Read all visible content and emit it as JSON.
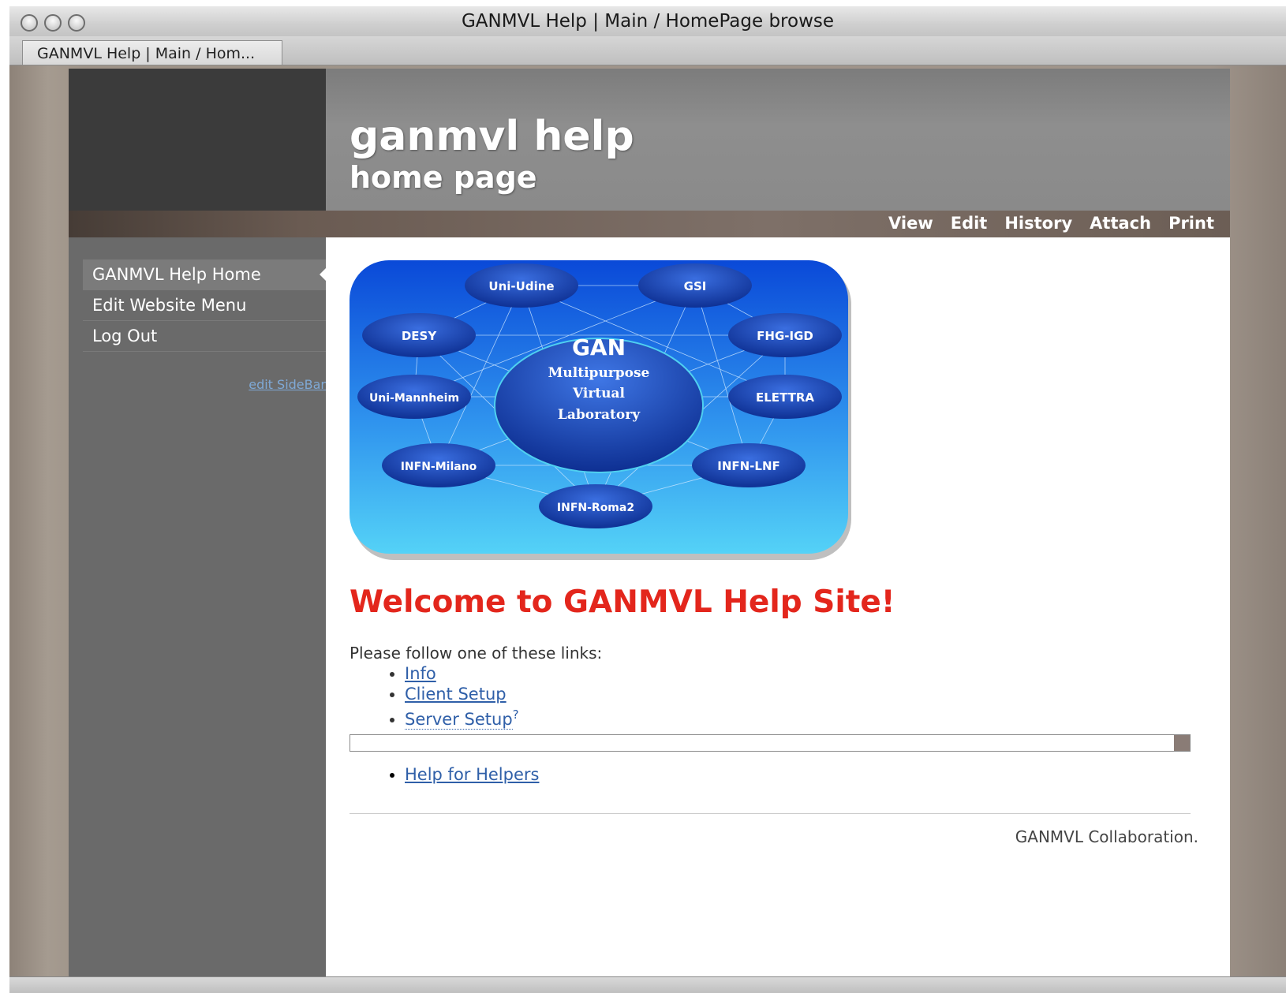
{
  "window": {
    "title": "GANMVL Help | Main / HomePage browse",
    "tab_label": "GANMVL Help | Main / Hom..."
  },
  "header": {
    "title": "ganmvl help",
    "subtitle": "home page"
  },
  "actions": [
    "View",
    "Edit",
    "History",
    "Attach",
    "Print"
  ],
  "sidebar": {
    "items": [
      {
        "label": "GANMVL Help Home",
        "active": true
      },
      {
        "label": "Edit Website Menu",
        "active": false
      },
      {
        "label": "Log Out",
        "active": false
      }
    ],
    "edit_sidebar": "edit SideBar"
  },
  "diagram": {
    "center_title": "GAN",
    "center_lines": [
      "Multipurpose",
      "Virtual",
      "Laboratory"
    ],
    "nodes": [
      "Uni-Udine",
      "GSI",
      "DESY",
      "FHG-IGD",
      "Uni-Mannheim",
      "ELETTRA",
      "INFN-Milano",
      "INFN-LNF",
      "INFN-Roma2"
    ]
  },
  "main": {
    "welcome": "Welcome to GANMVL Help Site!",
    "intro": "Please follow one of these links:",
    "links": [
      "Info",
      "Client Setup",
      "Server Setup"
    ],
    "server_setup_mark": "?",
    "links_after": [
      "Help for Helpers"
    ],
    "footer": "GANMVL Collaboration."
  },
  "colors": {
    "welcome": "#e3261c",
    "link": "#2f5fa8",
    "sidebar": "#6a6a6a",
    "header": "#8a8a8a"
  }
}
